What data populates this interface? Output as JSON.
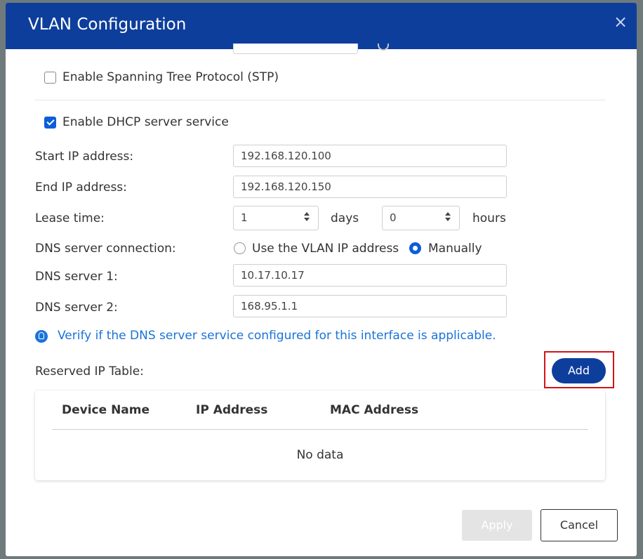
{
  "dialog": {
    "title": "VLAN Configuration",
    "close_label": "×"
  },
  "stp": {
    "label": "Enable Spanning Tree Protocol (STP)",
    "checked": false
  },
  "dhcp": {
    "label": "Enable DHCP server service",
    "checked": true,
    "start_ip_label": "Start IP address:",
    "start_ip_value": "192.168.120.100",
    "end_ip_label": "End IP address:",
    "end_ip_value": "192.168.120.150",
    "lease_label": "Lease time:",
    "lease_days_value": "1",
    "lease_days_unit": "days",
    "lease_hours_value": "0",
    "lease_hours_unit": "hours",
    "dns_conn_label": "DNS server connection:",
    "dns_option_vlan": "Use the VLAN IP address",
    "dns_option_manual": "Manually",
    "dns_selected": "Manually",
    "dns1_label": "DNS server 1:",
    "dns1_value": "10.17.10.17",
    "dns2_label": "DNS server 2:",
    "dns2_value": "168.95.1.1",
    "info_text": "Verify if the DNS server service configured for this interface is applicable."
  },
  "reserved": {
    "label": "Reserved IP Table:",
    "add_label": "Add",
    "columns": [
      "Device Name",
      "IP Address",
      "MAC Address"
    ],
    "empty_text": "No data"
  },
  "footer": {
    "apply_label": "Apply",
    "cancel_label": "Cancel"
  },
  "colors": {
    "header": "#0e3e9c",
    "accent": "#0b5ed7",
    "info": "#1a73d9",
    "highlight": "#d0141b"
  }
}
